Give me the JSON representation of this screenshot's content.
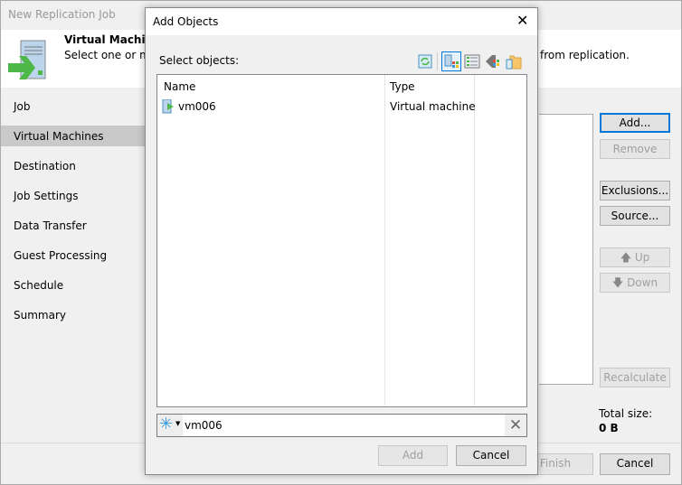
{
  "window": {
    "title": "New Replication Job"
  },
  "header": {
    "title": "Virtual Machines",
    "description": "Select one or mo",
    "description_tail": "from replication."
  },
  "nav": [
    {
      "label": "Job"
    },
    {
      "label": "Virtual Machines",
      "selected": true
    },
    {
      "label": "Destination"
    },
    {
      "label": "Job Settings"
    },
    {
      "label": "Data Transfer"
    },
    {
      "label": "Guest Processing"
    },
    {
      "label": "Schedule"
    },
    {
      "label": "Summary"
    }
  ],
  "side_buttons": {
    "add": "Add...",
    "remove": "Remove",
    "exclusions": "Exclusions...",
    "source": "Source...",
    "up": "Up",
    "down": "Down",
    "recalculate": "Recalculate"
  },
  "total": {
    "label": "Total size:",
    "value": "0 B"
  },
  "footer": {
    "finish": "Finish",
    "cancel": "Cancel"
  },
  "dialog": {
    "title": "Add Objects",
    "select_label": "Select objects:",
    "columns": [
      "Name",
      "Type"
    ],
    "rows": [
      {
        "name": "vm006",
        "type": "Virtual machine"
      }
    ],
    "search_value": "vm006",
    "add": "Add",
    "cancel": "Cancel"
  },
  "colors": {
    "accent": "#0078d7",
    "green": "#4db848"
  }
}
